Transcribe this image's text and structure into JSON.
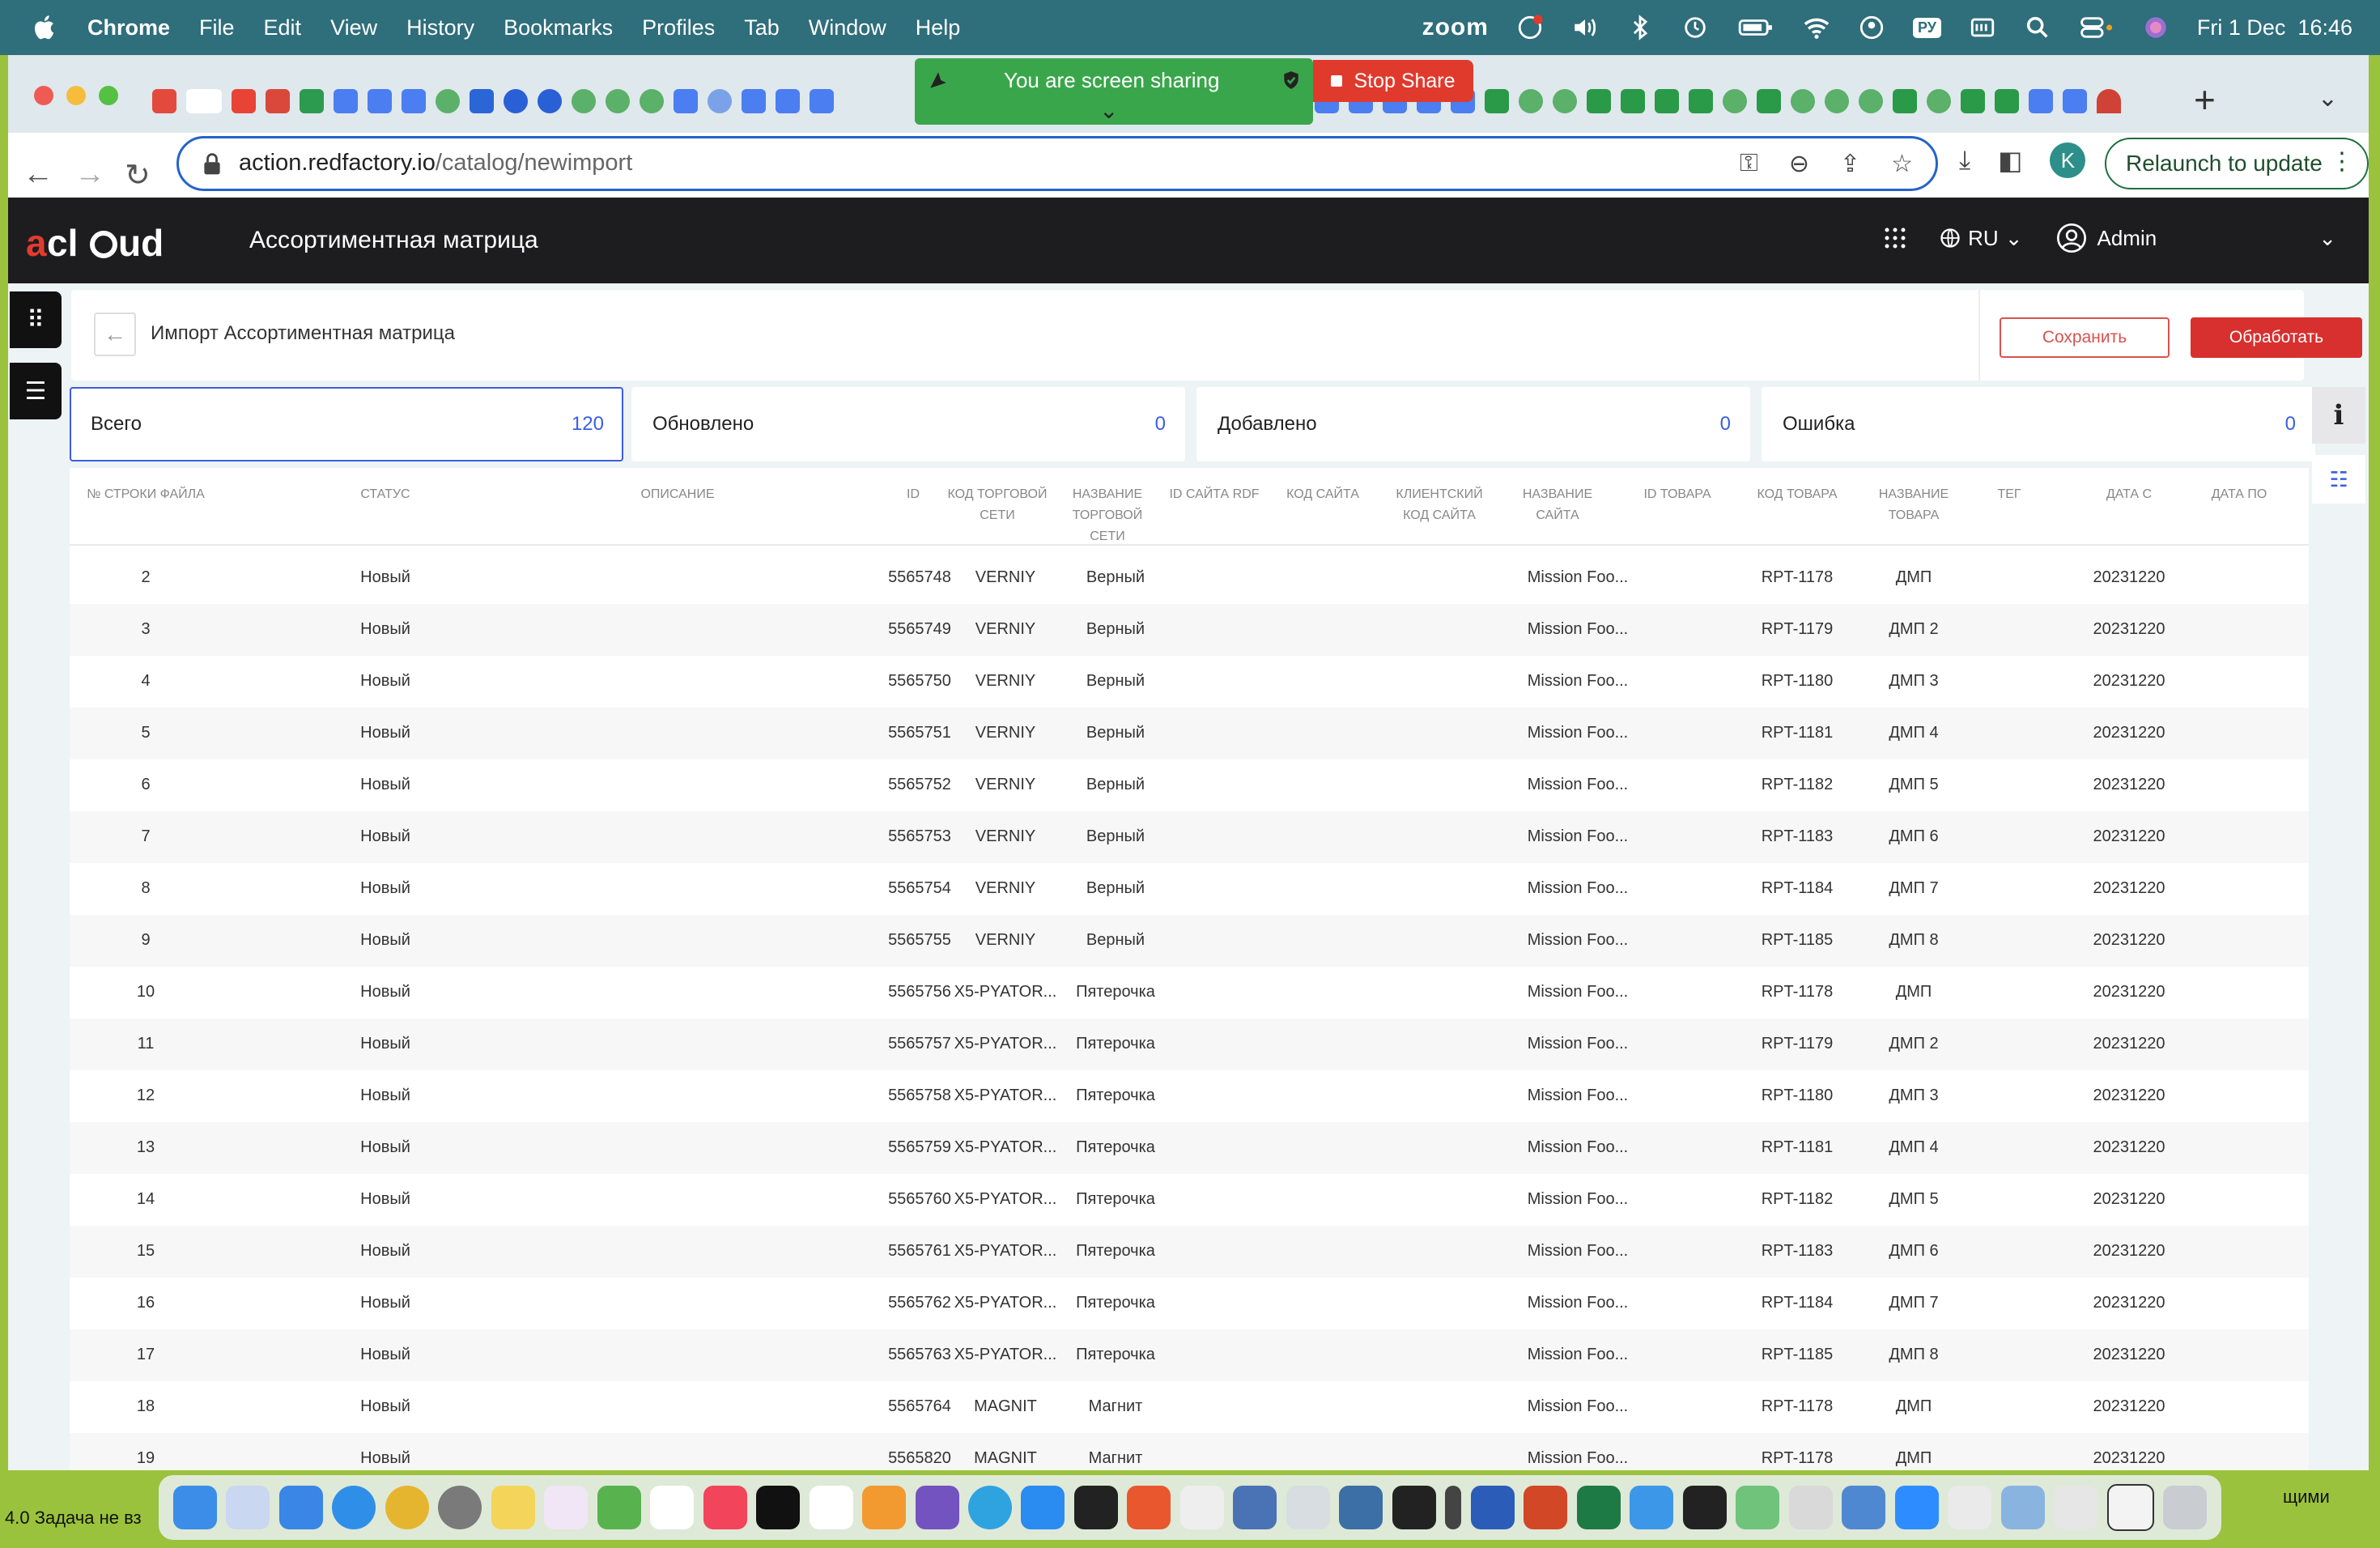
{
  "menubar": {
    "app": "Chrome",
    "items": [
      "File",
      "Edit",
      "View",
      "History",
      "Bookmarks",
      "Profiles",
      "Tab",
      "Window",
      "Help"
    ],
    "zoom": "zoom",
    "keyboard": "РУ",
    "datetime": "Fri 1 Dec  16:46"
  },
  "sharing": {
    "status": "You are screen sharing",
    "stop": "Stop Share"
  },
  "browser": {
    "url_host": "action.redfactory.io",
    "url_path": "/catalog/newimport",
    "profile_initial": "K",
    "relaunch": "Relaunch to update"
  },
  "app": {
    "logo": "acloud",
    "title": "Ассортиментная матрица",
    "language": "RU",
    "user": "Admin"
  },
  "page": {
    "title": "Импорт Ассортиментная матрица",
    "save": "Сохранить",
    "process": "Обработать"
  },
  "stats": [
    {
      "label": "Всего",
      "value": "120"
    },
    {
      "label": "Обновлено",
      "value": "0"
    },
    {
      "label": "Добавлено",
      "value": "0"
    },
    {
      "label": "Ошибка",
      "value": "0"
    }
  ],
  "table": {
    "columns": [
      "№ строки файла",
      "Статус",
      "Описание",
      "ID",
      "Код торговой сети",
      "Название торговой сети",
      "ID сайта RDF",
      "Код сайта",
      "Клиентский код сайта",
      "Название сайта",
      "ID товара",
      "Код товара",
      "Название товара",
      "Тег",
      "Дата с",
      "Дата по"
    ],
    "rows": [
      {
        "n": "2",
        "status": "Новый",
        "id": "5565748",
        "chain_code": "VERNIY",
        "chain_name": "Верный",
        "site_name": "Mission Foo...",
        "item_code": "RPT-1178",
        "item_name": "ДМП",
        "date_from": "20231220"
      },
      {
        "n": "3",
        "status": "Новый",
        "id": "5565749",
        "chain_code": "VERNIY",
        "chain_name": "Верный",
        "site_name": "Mission Foo...",
        "item_code": "RPT-1179",
        "item_name": "ДМП 2",
        "date_from": "20231220"
      },
      {
        "n": "4",
        "status": "Новый",
        "id": "5565750",
        "chain_code": "VERNIY",
        "chain_name": "Верный",
        "site_name": "Mission Foo...",
        "item_code": "RPT-1180",
        "item_name": "ДМП 3",
        "date_from": "20231220"
      },
      {
        "n": "5",
        "status": "Новый",
        "id": "5565751",
        "chain_code": "VERNIY",
        "chain_name": "Верный",
        "site_name": "Mission Foo...",
        "item_code": "RPT-1181",
        "item_name": "ДМП 4",
        "date_from": "20231220"
      },
      {
        "n": "6",
        "status": "Новый",
        "id": "5565752",
        "chain_code": "VERNIY",
        "chain_name": "Верный",
        "site_name": "Mission Foo...",
        "item_code": "RPT-1182",
        "item_name": "ДМП 5",
        "date_from": "20231220"
      },
      {
        "n": "7",
        "status": "Новый",
        "id": "5565753",
        "chain_code": "VERNIY",
        "chain_name": "Верный",
        "site_name": "Mission Foo...",
        "item_code": "RPT-1183",
        "item_name": "ДМП 6",
        "date_from": "20231220"
      },
      {
        "n": "8",
        "status": "Новый",
        "id": "5565754",
        "chain_code": "VERNIY",
        "chain_name": "Верный",
        "site_name": "Mission Foo...",
        "item_code": "RPT-1184",
        "item_name": "ДМП 7",
        "date_from": "20231220"
      },
      {
        "n": "9",
        "status": "Новый",
        "id": "5565755",
        "chain_code": "VERNIY",
        "chain_name": "Верный",
        "site_name": "Mission Foo...",
        "item_code": "RPT-1185",
        "item_name": "ДМП 8",
        "date_from": "20231220"
      },
      {
        "n": "10",
        "status": "Новый",
        "id": "5565756",
        "chain_code": "X5-PYATOR...",
        "chain_name": "Пятерочка",
        "site_name": "Mission Foo...",
        "item_code": "RPT-1178",
        "item_name": "ДМП",
        "date_from": "20231220"
      },
      {
        "n": "11",
        "status": "Новый",
        "id": "5565757",
        "chain_code": "X5-PYATOR...",
        "chain_name": "Пятерочка",
        "site_name": "Mission Foo...",
        "item_code": "RPT-1179",
        "item_name": "ДМП 2",
        "date_from": "20231220"
      },
      {
        "n": "12",
        "status": "Новый",
        "id": "5565758",
        "chain_code": "X5-PYATOR...",
        "chain_name": "Пятерочка",
        "site_name": "Mission Foo...",
        "item_code": "RPT-1180",
        "item_name": "ДМП 3",
        "date_from": "20231220"
      },
      {
        "n": "13",
        "status": "Новый",
        "id": "5565759",
        "chain_code": "X5-PYATOR...",
        "chain_name": "Пятерочка",
        "site_name": "Mission Foo...",
        "item_code": "RPT-1181",
        "item_name": "ДМП 4",
        "date_from": "20231220"
      },
      {
        "n": "14",
        "status": "Новый",
        "id": "5565760",
        "chain_code": "X5-PYATOR...",
        "chain_name": "Пятерочка",
        "site_name": "Mission Foo...",
        "item_code": "RPT-1182",
        "item_name": "ДМП 5",
        "date_from": "20231220"
      },
      {
        "n": "15",
        "status": "Новый",
        "id": "5565761",
        "chain_code": "X5-PYATOR...",
        "chain_name": "Пятерочка",
        "site_name": "Mission Foo...",
        "item_code": "RPT-1183",
        "item_name": "ДМП 6",
        "date_from": "20231220"
      },
      {
        "n": "16",
        "status": "Новый",
        "id": "5565762",
        "chain_code": "X5-PYATOR...",
        "chain_name": "Пятерочка",
        "site_name": "Mission Foo...",
        "item_code": "RPT-1184",
        "item_name": "ДМП 7",
        "date_from": "20231220"
      },
      {
        "n": "17",
        "status": "Новый",
        "id": "5565763",
        "chain_code": "X5-PYATOR...",
        "chain_name": "Пятерочка",
        "site_name": "Mission Foo...",
        "item_code": "RPT-1185",
        "item_name": "ДМП 8",
        "date_from": "20231220"
      },
      {
        "n": "18",
        "status": "Новый",
        "id": "5565764",
        "chain_code": "MAGNIT",
        "chain_name": "Магнит",
        "site_name": "Mission Foo...",
        "item_code": "RPT-1178",
        "item_name": "ДМП",
        "date_from": "20231220"
      },
      {
        "n": "19",
        "status": "Новый",
        "id": "5565820",
        "chain_code": "MAGNIT",
        "chain_name": "Магнит",
        "site_name": "Mission Foo...",
        "item_code": "RPT-1178",
        "item_name": "ДМП",
        "date_from": "20231220"
      }
    ]
  },
  "desktop": {
    "left_text": "4.0 Задача не вз",
    "right_text": "щими"
  },
  "colors": {
    "accent": "#3c5de0",
    "danger": "#d7302e",
    "header": "#1d1d1f",
    "menubar": "#2f6e7b",
    "sharing": "#3aa64b"
  }
}
